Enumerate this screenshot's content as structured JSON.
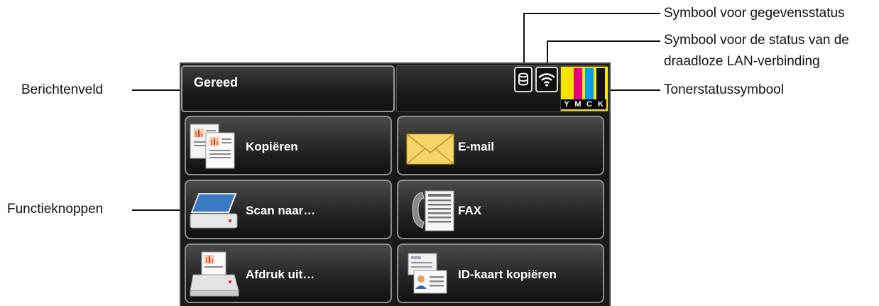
{
  "callouts": {
    "data_status": "Symbool voor gegevensstatus",
    "wireless_line1": "Symbool voor de status van de",
    "wireless_line2": "draadloze LAN-verbinding",
    "toner_status": "Tonerstatussymbool",
    "message_field": "Berichtenveld",
    "function_buttons": "Functieknoppen"
  },
  "screen": {
    "message": "Gereed",
    "toner_labels": [
      "Y",
      "M",
      "C",
      "K"
    ],
    "toner_colors": [
      "#f5e300",
      "#e6007e",
      "#00a0e9",
      "#111111"
    ],
    "buttons": [
      {
        "label": "Kopiëren",
        "icon": "copy-icon"
      },
      {
        "label": "E-mail",
        "icon": "envelope-icon"
      },
      {
        "label": "Scan naar…",
        "icon": "scanner-icon"
      },
      {
        "label": "FAX",
        "icon": "fax-icon"
      },
      {
        "label": "Afdruk uit…",
        "icon": "printer-icon"
      },
      {
        "label": "ID-kaart kopiëren",
        "icon": "id-card-icon"
      }
    ]
  }
}
